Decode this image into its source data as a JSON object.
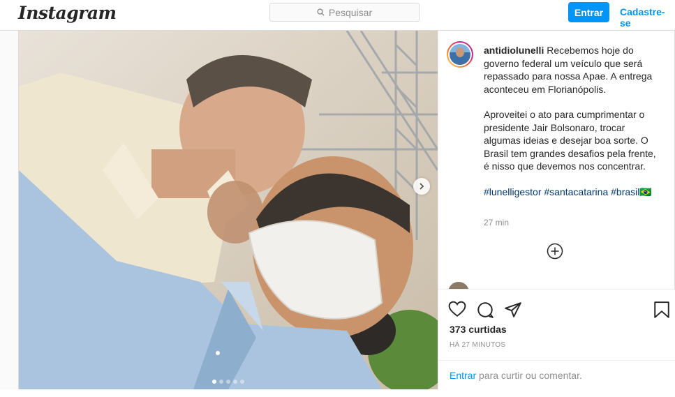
{
  "header": {
    "logo_text": "Instagram",
    "search_placeholder": "Pesquisar",
    "login_label": "Entrar",
    "signup_label": "Cadastre-se"
  },
  "post": {
    "username": "antidiolunelli",
    "caption_p1": "Recebemos hoje do governo federal um veículo que será repassado para nossa Apae. A entrega aconteceu em Florianópolis.",
    "caption_p2": "Aproveitei o ato para cumprimentar o presidente Jair Bolsonaro, trocar algumas ideias e desejar boa sorte. O Brasil tem grandes desafios pela frente, é nisso que devemos nos concentrar.",
    "hashtags": "#lunelligestor #santacatarina #brasil🇧🇷",
    "caption_time": "27 min",
    "likes": "373 curtidas",
    "posted_ago": "HÁ 27 MINUTOS",
    "comment_login": "Entrar",
    "comment_prompt": " para curtir ou comentar.",
    "carousel_total": 5,
    "carousel_current": 1
  },
  "icons": {
    "like": "heart-icon",
    "comment": "comment-icon",
    "share": "send-icon",
    "save": "bookmark-icon",
    "more": "plus-circle-icon",
    "next": "chevron-right-icon",
    "search": "search-icon"
  },
  "colors": {
    "accent": "#0095f6",
    "hashtag": "#00376b",
    "muted": "#8e8e8e",
    "border": "#dbdbdb"
  }
}
